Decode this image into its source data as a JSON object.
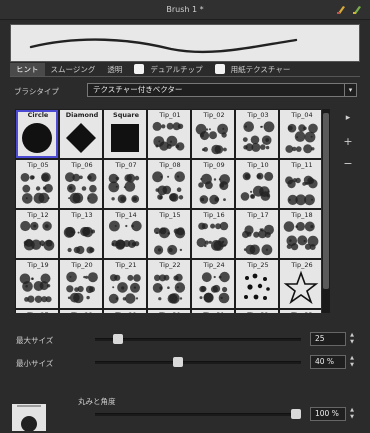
{
  "window": {
    "title": "Brush 1 *"
  },
  "tabs": [
    {
      "label": "ヒント",
      "active": true
    },
    {
      "label": "スムージング",
      "active": false
    },
    {
      "label": "透明",
      "active": false
    },
    {
      "label": "デュアルチップ",
      "checkbox": true
    },
    {
      "label": "用紙テクスチャー",
      "checkbox": true
    }
  ],
  "brush_type": {
    "label": "ブラシタイプ",
    "value": "テクスチャー付きベクター"
  },
  "tips": [
    "Circle",
    "Diamond",
    "Square",
    "Tip_01",
    "Tip_02",
    "Tip_03",
    "Tip_04",
    "Tip_05",
    "Tip_06",
    "Tip_07",
    "Tip_08",
    "Tip_09",
    "Tip_10",
    "Tip_11",
    "Tip_12",
    "Tip_13",
    "Tip_14",
    "Tip_15",
    "Tip_16",
    "Tip_17",
    "Tip_18",
    "Tip_19",
    "Tip_20",
    "Tip_21",
    "Tip_22",
    "Tip_24",
    "Tip_25",
    "Tip_26",
    "Tip_27",
    "Tip_28",
    "Tip_29",
    "Tip_30",
    "Tip_31",
    "Tip_32",
    "Tip_33"
  ],
  "selected_tip": "Circle",
  "max_size": {
    "label": "最大サイズ",
    "value": "25",
    "fraction": 0.09
  },
  "min_size": {
    "label": "最小サイズ",
    "value": "40 %",
    "fraction": 0.4
  },
  "roundness": {
    "label": "丸みと角度",
    "value": "100 %",
    "fraction": 1.0
  }
}
